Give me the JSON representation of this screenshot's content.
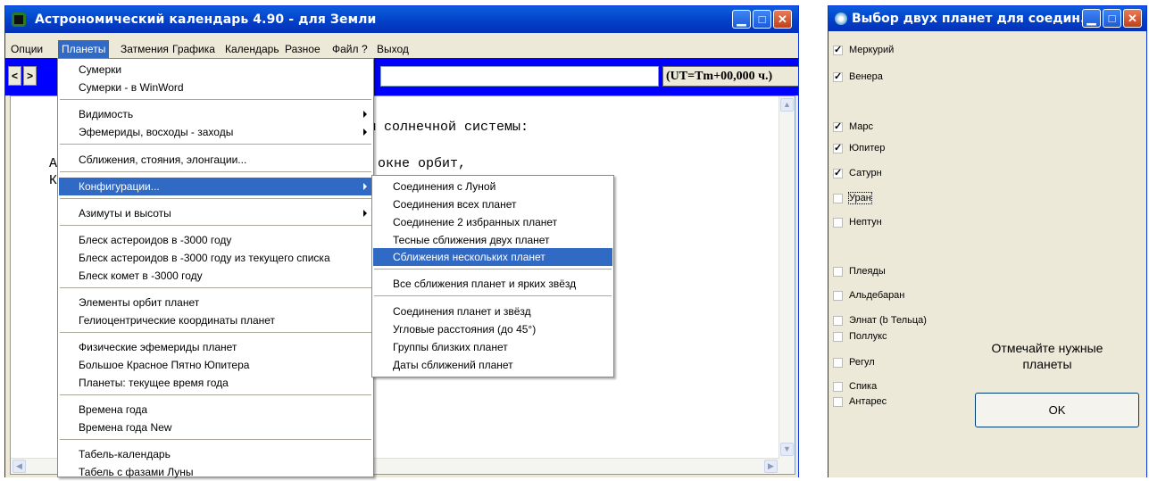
{
  "main_window": {
    "title": "Астрономический календарь 4.90 - для Земли",
    "menu": [
      "Опции",
      "Планеты",
      "Затмения",
      "Графика",
      "Календарь",
      "Разное",
      "Файл",
      "?",
      "Выход"
    ],
    "nav_prev": "<",
    "nav_next": ">",
    "ut_label": "(UT=Tm+00,000 ч.)",
    "text_lines": [
      "ы солнечной системы:",
      "А",
      "окне орбит,",
      "К"
    ]
  },
  "dropdown": {
    "items": [
      "Сумерки",
      "Сумерки - в WinWord",
      "Видимость",
      "Эфемериды, восходы - заходы",
      "Сближения, стояния, элонгации...",
      "Конфигурации...",
      "Азимуты и высоты",
      "Блеск астероидов в -3000 году",
      "Блеск астероидов в -3000 году из текущего списка",
      "Блеск комет в -3000 году",
      "Элементы орбит планет",
      "Гелиоцентрические координаты планет",
      "Физические эфемериды планет",
      "Большое Красное Пятно Юпитера",
      "Планеты: текущее время года",
      "Времена года",
      "Времена года New",
      "Табель-календарь",
      "Табель с фазами Луны"
    ]
  },
  "submenu": {
    "items": [
      "Соединения с Луной",
      "Соединения всех планет",
      "Соединение 2 избранных планет",
      "Тесные сближения двух планет",
      "Сближения нескольких планет",
      "Все сближения планет и ярких звёзд",
      "Соединения планет и звёзд",
      "Угловые расстояния (до 45°)",
      "Группы близких планет",
      "Даты сближений планет"
    ]
  },
  "dialog": {
    "title": "Выбор двух планет для соедин...",
    "checkboxes": [
      {
        "label": "Меркурий",
        "checked": true
      },
      {
        "label": "Венера",
        "checked": true
      },
      {
        "label": "Марс",
        "checked": true
      },
      {
        "label": "Юпитер",
        "checked": true
      },
      {
        "label": "Сатурн",
        "checked": true
      },
      {
        "label": "Уран",
        "checked": false
      },
      {
        "label": "Нептун",
        "checked": false
      },
      {
        "label": "Плеяды",
        "checked": false
      },
      {
        "label": "Альдебаран",
        "checked": false
      },
      {
        "label": "Элнат (b Тельца)",
        "checked": false
      },
      {
        "label": "Поллукс",
        "checked": false
      },
      {
        "label": "Регул",
        "checked": false
      },
      {
        "label": "Спика",
        "checked": false
      },
      {
        "label": "Антарес",
        "checked": false
      }
    ],
    "hint_line1": "Отмечайте нужные",
    "hint_line2": "планеты",
    "ok_label": "OK"
  }
}
